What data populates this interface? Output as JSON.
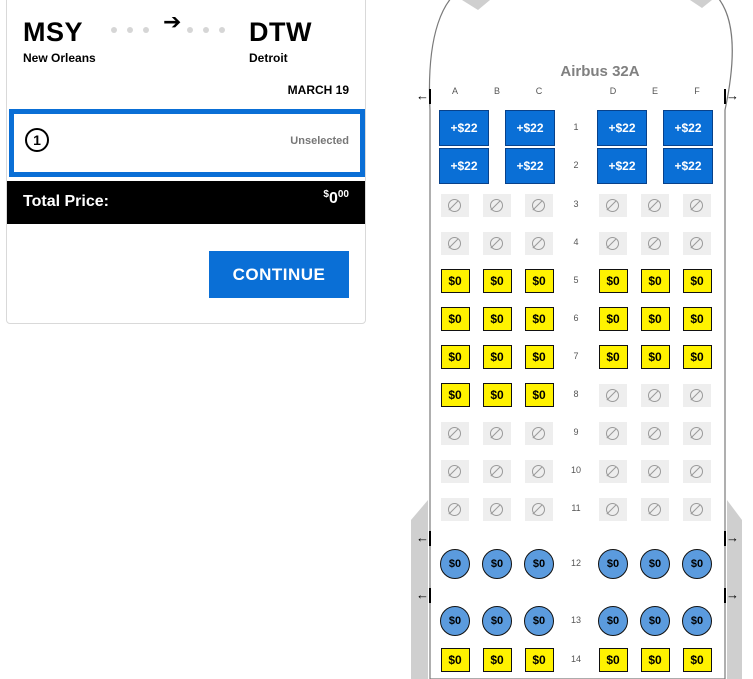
{
  "flight": {
    "origin_code": "MSY",
    "origin_city": "New Orleans",
    "destination_code": "DTW",
    "destination_city": "Detroit",
    "date": "MARCH 19",
    "arrow_icon": "arrow-right-icon"
  },
  "passenger": {
    "number": "1",
    "status": "Unselected"
  },
  "total": {
    "label": "Total Price:",
    "currency": "$",
    "whole": "0",
    "cents": "00"
  },
  "continue_label": "CONTINUE",
  "aircraft": "Airbus 32A",
  "columns": [
    "A",
    "B",
    "C",
    "D",
    "E",
    "F"
  ],
  "rows": [
    {
      "num": "1",
      "type": "premium",
      "seats": [
        "+$22",
        "+$22",
        "+$22",
        "+$22"
      ]
    },
    {
      "num": "2",
      "type": "premium",
      "seats": [
        "+$22",
        "+$22",
        "+$22",
        "+$22"
      ]
    },
    {
      "num": "3",
      "type": "std",
      "seats": [
        null,
        null,
        null,
        null,
        null,
        null
      ]
    },
    {
      "num": "4",
      "type": "std",
      "seats": [
        null,
        null,
        null,
        null,
        null,
        null
      ]
    },
    {
      "num": "5",
      "type": "std",
      "seats": [
        "$0",
        "$0",
        "$0",
        "$0",
        "$0",
        "$0"
      ]
    },
    {
      "num": "6",
      "type": "std",
      "seats": [
        "$0",
        "$0",
        "$0",
        "$0",
        "$0",
        "$0"
      ]
    },
    {
      "num": "7",
      "type": "std",
      "seats": [
        "$0",
        "$0",
        "$0",
        "$0",
        "$0",
        "$0"
      ]
    },
    {
      "num": "8",
      "type": "std",
      "seats": [
        "$0",
        "$0",
        "$0",
        null,
        null,
        null
      ]
    },
    {
      "num": "9",
      "type": "std",
      "seats": [
        null,
        null,
        null,
        null,
        null,
        null
      ]
    },
    {
      "num": "10",
      "type": "std",
      "seats": [
        null,
        null,
        null,
        null,
        null,
        null
      ]
    },
    {
      "num": "11",
      "type": "std",
      "seats": [
        null,
        null,
        null,
        null,
        null,
        null
      ]
    },
    {
      "num": "12",
      "type": "exit",
      "seats": [
        "$0",
        "$0",
        "$0",
        "$0",
        "$0",
        "$0"
      ]
    },
    {
      "num": "13",
      "type": "exit",
      "seats": [
        "$0",
        "$0",
        "$0",
        "$0",
        "$0",
        "$0"
      ]
    },
    {
      "num": "14",
      "type": "std",
      "seats": [
        "$0",
        "$0",
        "$0",
        "$0",
        "$0",
        "$0"
      ]
    }
  ],
  "colors": {
    "brand_blue": "#0a6fd6",
    "standard_seat": "#fff200",
    "exit_row_seat": "#5b9bde",
    "unavailable_seat": "#eeeeee"
  },
  "icons": {
    "unavailable": "no-entry-icon",
    "exit": "exit-arrow-icon"
  }
}
